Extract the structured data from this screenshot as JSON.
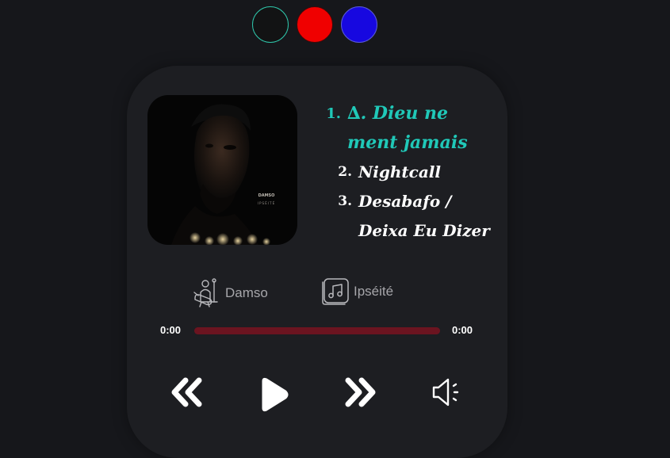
{
  "theme_switcher": {
    "swatches": [
      {
        "name": "dark",
        "color": "#121314"
      },
      {
        "name": "red",
        "color": "#f00000"
      },
      {
        "name": "blue",
        "color": "#1708e0"
      }
    ]
  },
  "player": {
    "album_cover": {
      "artist_text": "DAMSO",
      "album_text": "IPSÉITÉ"
    },
    "tracklist": [
      {
        "number": "1.",
        "title": "∆. Dieu ne ment jamais",
        "active": true
      },
      {
        "number": "2.",
        "title": "Nightcall",
        "active": false
      },
      {
        "number": "3.",
        "title": "Desabafo / Deixa Eu Dizer",
        "active": false
      }
    ],
    "artist_icon": "singer-with-guitar-icon",
    "artist": "Damso",
    "album_icon": "music-album-icon",
    "album": "Ipséité",
    "time_elapsed": "0:00",
    "time_total": "0:00",
    "progress": 0,
    "controls": {
      "previous_icon": "double-chevron-left-icon",
      "play_icon": "play-icon",
      "next_icon": "double-chevron-right-icon",
      "volume_icon": "speaker-icon"
    },
    "colors": {
      "accent": "#20c8b8",
      "progress_track": "#6b1420",
      "card": "#1d1e22",
      "background": "#16171b"
    }
  }
}
